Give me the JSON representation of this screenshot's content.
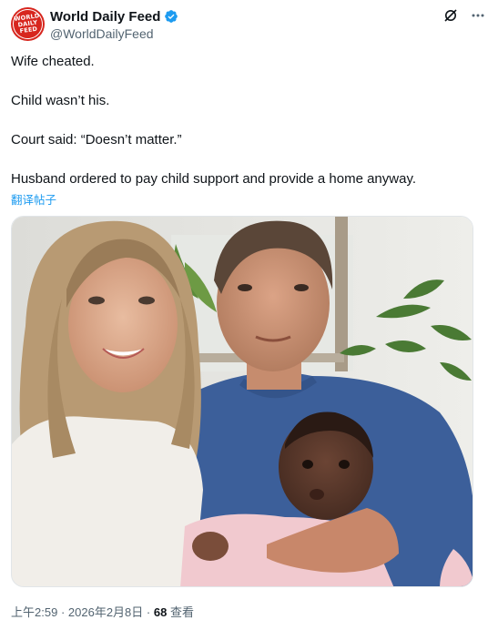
{
  "account": {
    "logo_lines": [
      "WORLD",
      "DAILY",
      "FEED"
    ],
    "display_name": "World Daily Feed",
    "handle": "@WorldDailyFeed"
  },
  "header_icons": [
    "grok-icon",
    "more-icon"
  ],
  "tweet": {
    "line1": "Wife cheated.",
    "line2": "Child wasn’t his.",
    "line3": "Court said: “Doesn’t matter.”",
    "line4": "Husband ordered to pay child support and provide a home anyway.",
    "translate_link": "翻译帖子"
  },
  "meta": {
    "time": "上午2:59",
    "separator1": "·",
    "date": "2026年2月8日",
    "separator2": "·",
    "views_count": "68",
    "views_label": "查看"
  },
  "colors": {
    "accent": "#1d9bf0",
    "logo_red": "#d7261e",
    "secondary_text": "#536471"
  }
}
